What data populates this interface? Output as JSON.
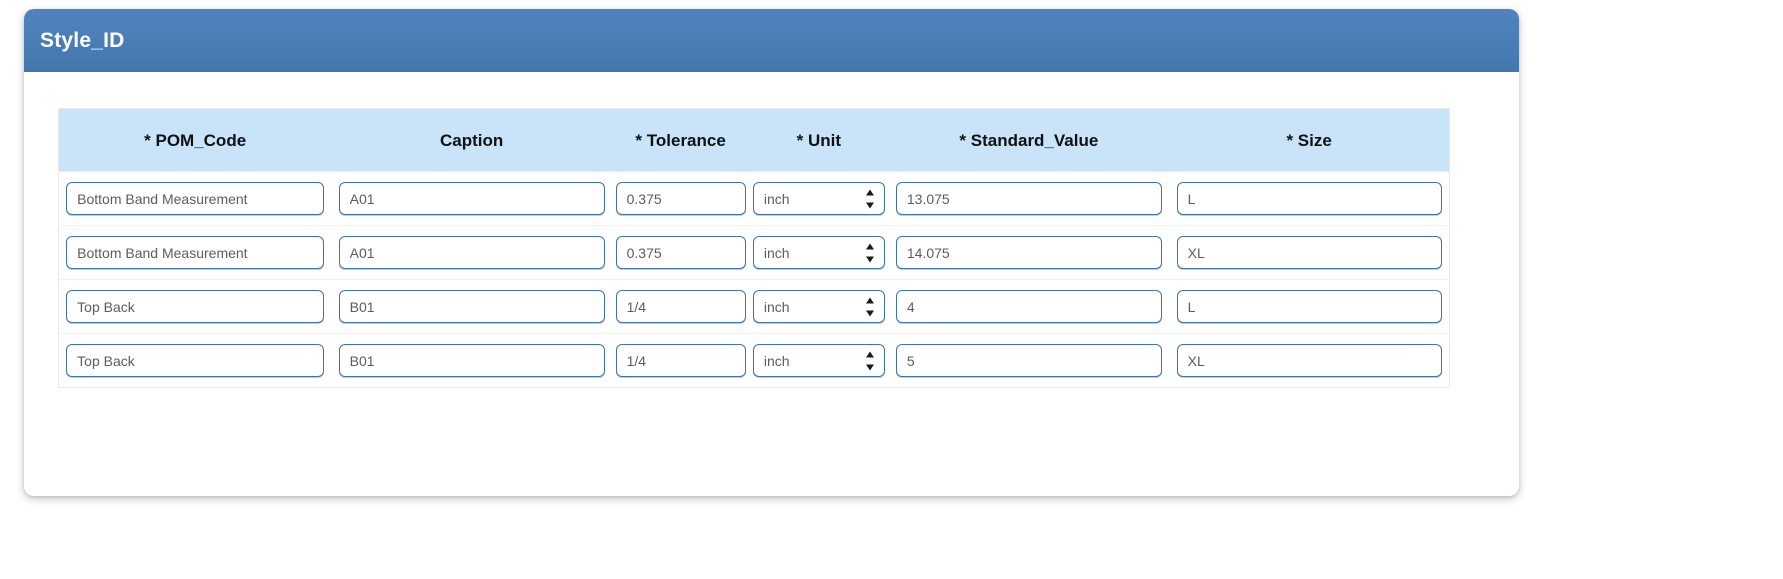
{
  "card": {
    "title": "Style_ID"
  },
  "table": {
    "columns": [
      {
        "label": "* POM_Code",
        "key": "pom_code"
      },
      {
        "label": "Caption",
        "key": "caption"
      },
      {
        "label": "* Tolerance",
        "key": "tolerance"
      },
      {
        "label": "* Unit",
        "key": "unit"
      },
      {
        "label": "* Standard_Value",
        "key": "standard_value"
      },
      {
        "label": "* Size",
        "key": "size"
      }
    ],
    "rows": [
      {
        "pom_code": "Bottom Band Measurement",
        "caption": "A01",
        "tolerance": "0.375",
        "unit": "inch",
        "standard_value": "13.075",
        "size": "L"
      },
      {
        "pom_code": "Bottom Band Measurement",
        "caption": "A01",
        "tolerance": "0.375",
        "unit": "inch",
        "standard_value": "14.075",
        "size": "XL"
      },
      {
        "pom_code": "Top Back",
        "caption": "B01",
        "tolerance": "1/4",
        "unit": "inch",
        "standard_value": "4",
        "size": "L"
      },
      {
        "pom_code": "Top Back",
        "caption": "B01",
        "tolerance": "1/4",
        "unit": "inch",
        "standard_value": "5",
        "size": "XL"
      }
    ],
    "unit_options": [
      "inch"
    ]
  },
  "colors": {
    "header_bar": "#4a7bb5",
    "table_header": "#c9e4f9",
    "field_border": "#3d74ae",
    "field_text": "#5c5c5c"
  }
}
